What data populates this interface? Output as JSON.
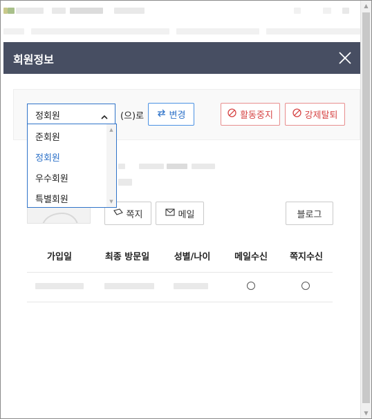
{
  "modal": {
    "title": "회원정보"
  },
  "grade": {
    "selected": "정회원",
    "suffix": "(으)로",
    "options": [
      "준회원",
      "정회원",
      "우수회원",
      "특별회원"
    ],
    "selected_index": 1
  },
  "actions": {
    "change_label": "변경",
    "suspend_label": "활동중지",
    "kick_label": "강제탈퇴"
  },
  "profile_buttons": {
    "message_label": "쪽지",
    "mail_label": "메일",
    "blog_label": "블로그"
  },
  "info_table": {
    "headers": [
      "가입일",
      "최종 방문일",
      "성별/나이",
      "메일수신",
      "쪽지수신"
    ]
  },
  "colors": {
    "titlebar": "#474e62",
    "accent_blue": "#2f73c9",
    "danger_red": "#d64545"
  },
  "icons": [
    "close-icon",
    "chevron-up-icon",
    "swap-icon",
    "ban-icon",
    "envelope-icon",
    "message-icon"
  ]
}
